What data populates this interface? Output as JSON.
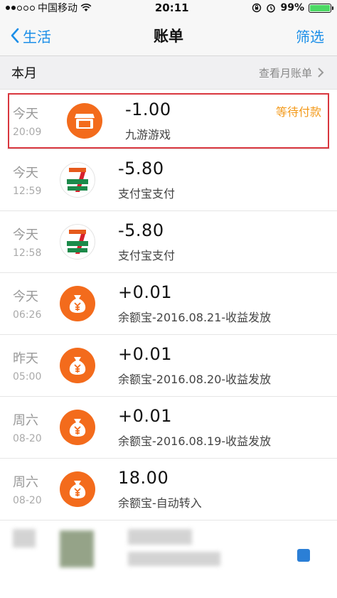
{
  "status_bar": {
    "carrier": "中国移动",
    "time": "20:11",
    "battery": "99%",
    "battery_level": 0.99,
    "signal_dots": 5,
    "signal_filled": 2
  },
  "nav": {
    "back_label": "生活",
    "title": "账单",
    "filter_label": "筛选"
  },
  "section": {
    "title": "本月",
    "link_label": "查看月账单"
  },
  "transactions": [
    {
      "day": "今天",
      "time": "20:09",
      "amount": "-1.00",
      "desc": "九游游戏",
      "status": "等待付款",
      "icon": "store-icon"
    },
    {
      "day": "今天",
      "time": "12:59",
      "amount": "-5.80",
      "desc": "支付宝支付",
      "status": "",
      "icon": "seven-eleven-icon"
    },
    {
      "day": "今天",
      "time": "12:58",
      "amount": "-5.80",
      "desc": "支付宝支付",
      "status": "",
      "icon": "seven-eleven-icon"
    },
    {
      "day": "今天",
      "time": "06:26",
      "amount": "+0.01",
      "desc": "余额宝-2016.08.21-收益发放",
      "status": "",
      "icon": "money-bag-icon"
    },
    {
      "day": "昨天",
      "time": "05:00",
      "amount": "+0.01",
      "desc": "余额宝-2016.08.20-收益发放",
      "status": "",
      "icon": "money-bag-icon"
    },
    {
      "day": "周六",
      "time": "08-20",
      "amount": "+0.01",
      "desc": "余额宝-2016.08.19-收益发放",
      "status": "",
      "icon": "money-bag-icon"
    },
    {
      "day": "周六",
      "time": "08-20",
      "amount": "18.00",
      "desc": "余额宝-自动转入",
      "status": "",
      "icon": "money-bag-icon"
    }
  ],
  "colors": {
    "accent": "#1a8ee8",
    "icon_orange": "#f36b1c",
    "pending": "#f39a1b",
    "highlight_border": "#d9363e"
  }
}
